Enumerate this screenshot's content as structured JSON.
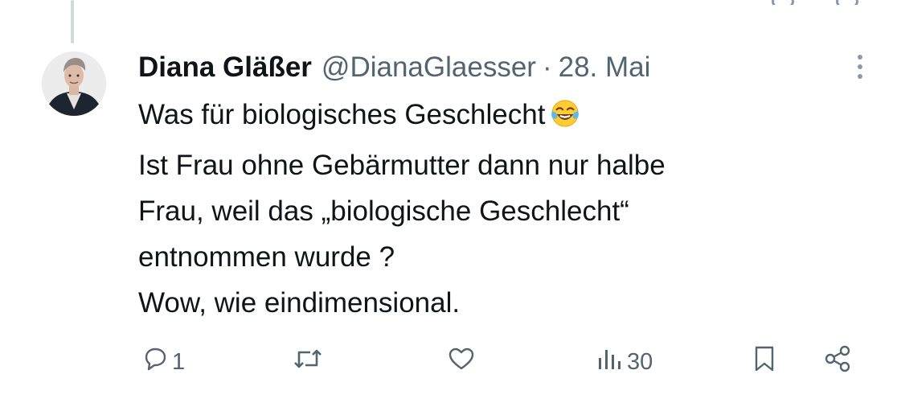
{
  "tweet": {
    "author_name": "Diana Gläßer",
    "handle": "@DianaGlaesser",
    "separator": "·",
    "date": "28. Mai",
    "lines": [
      "Was für biologisches Geschlecht",
      "Ist Frau ohne Gebärmutter dann nur halbe",
      "Frau, weil das „biologische Geschlecht“",
      "entnommen wurde ?",
      "Wow, wie eindimensional."
    ],
    "emoji": "face-with-tears-of-joy"
  },
  "actions": {
    "reply_count": "1",
    "repost_count": "",
    "like_count": "",
    "views_count": "30"
  },
  "colors": {
    "text": "#0f1419",
    "secondary": "#536471",
    "thread_line": "#cfd9de",
    "background": "#ffffff"
  }
}
